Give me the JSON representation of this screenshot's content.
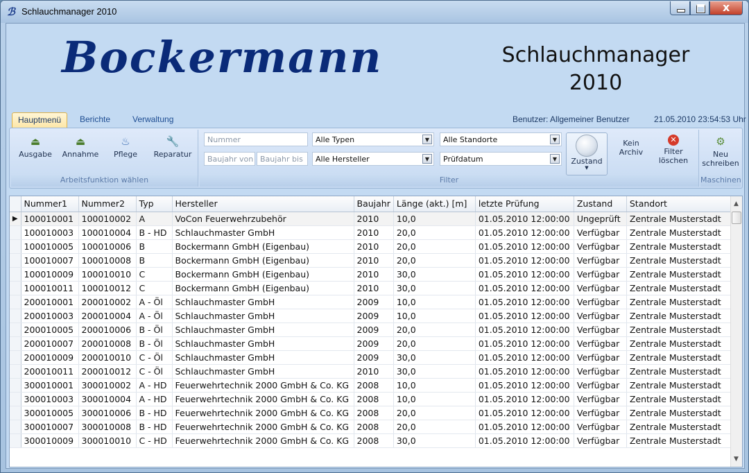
{
  "window": {
    "title": "Schlauchmanager 2010",
    "logo_glyph": "ℬ"
  },
  "header": {
    "brand": "Bockermann",
    "app_title_line1": "Schlauchmanager",
    "app_title_line2": "2010",
    "user": "Benutzer: Allgemeiner Benutzer",
    "datetime": "21.05.2010 23:54:53 Uhr"
  },
  "ribbon_tabs": [
    "Hauptmenü",
    "Berichte",
    "Verwaltung"
  ],
  "ribbon": {
    "arbeitsfunktion": {
      "label": "Arbeitsfunktion wählen",
      "buttons": [
        {
          "label": "Ausgabe",
          "icon": "hose-out-icon"
        },
        {
          "label": "Annahme",
          "icon": "hose-in-icon"
        },
        {
          "label": "Pflege",
          "icon": "care-icon"
        },
        {
          "label": "Reparatur",
          "icon": "wrench-icon"
        }
      ]
    },
    "filter": {
      "label": "Filter",
      "nummer_placeholder": "Nummer",
      "baujahr_von_placeholder": "Baujahr von",
      "baujahr_bis_placeholder": "Baujahr bis",
      "typ_value": "Alle Typen",
      "hersteller_value": "Alle Hersteller",
      "standort_value": "Alle Standorte",
      "pruefdatum_value": "Prüfdatum",
      "zustand_label": "Zustand",
      "kein_archiv_line1": "Kein",
      "kein_archiv_line2": "Archiv",
      "filter_loeschen_line1": "Filter",
      "filter_loeschen_line2": "löschen"
    },
    "maschinen": {
      "label": "Maschinen",
      "neu_line1": "Neu",
      "neu_line2": "schreiben"
    }
  },
  "table": {
    "columns": [
      "Nummer1",
      "Nummer2",
      "Typ",
      "Hersteller",
      "Baujahr",
      "Länge (akt.) [m]",
      "letzte Prüfung",
      "Zustand",
      "Standort"
    ],
    "rows": [
      [
        "100010001",
        "100010002",
        "A",
        "VoCon Feuerwehrzubehör",
        "2010",
        "10,0",
        "01.05.2010 12:00:00",
        "Ungeprüft",
        "Zentrale Musterstadt"
      ],
      [
        "100010003",
        "100010004",
        "B - HD",
        "Schlauchmaster GmbH",
        "2010",
        "20,0",
        "01.05.2010 12:00:00",
        "Verfügbar",
        "Zentrale Musterstadt"
      ],
      [
        "100010005",
        "100010006",
        "B",
        "Bockermann GmbH (Eigenbau)",
        "2010",
        "20,0",
        "01.05.2010 12:00:00",
        "Verfügbar",
        "Zentrale Musterstadt"
      ],
      [
        "100010007",
        "100010008",
        "B",
        "Bockermann GmbH (Eigenbau)",
        "2010",
        "20,0",
        "01.05.2010 12:00:00",
        "Verfügbar",
        "Zentrale Musterstadt"
      ],
      [
        "100010009",
        "100010010",
        "C",
        "Bockermann GmbH (Eigenbau)",
        "2010",
        "30,0",
        "01.05.2010 12:00:00",
        "Verfügbar",
        "Zentrale Musterstadt"
      ],
      [
        "100010011",
        "100010012",
        "C",
        "Bockermann GmbH (Eigenbau)",
        "2010",
        "30,0",
        "01.05.2010 12:00:00",
        "Verfügbar",
        "Zentrale Musterstadt"
      ],
      [
        "200010001",
        "200010002",
        "A - Öl",
        "Schlauchmaster GmbH",
        "2009",
        "10,0",
        "01.05.2010 12:00:00",
        "Verfügbar",
        "Zentrale Musterstadt"
      ],
      [
        "200010003",
        "200010004",
        "A - Öl",
        "Schlauchmaster GmbH",
        "2009",
        "10,0",
        "01.05.2010 12:00:00",
        "Verfügbar",
        "Zentrale Musterstadt"
      ],
      [
        "200010005",
        "200010006",
        "B - Öl",
        "Schlauchmaster GmbH",
        "2009",
        "20,0",
        "01.05.2010 12:00:00",
        "Verfügbar",
        "Zentrale Musterstadt"
      ],
      [
        "200010007",
        "200010008",
        "B - Öl",
        "Schlauchmaster GmbH",
        "2009",
        "20,0",
        "01.05.2010 12:00:00",
        "Verfügbar",
        "Zentrale Musterstadt"
      ],
      [
        "200010009",
        "200010010",
        "C - Öl",
        "Schlauchmaster GmbH",
        "2009",
        "30,0",
        "01.05.2010 12:00:00",
        "Verfügbar",
        "Zentrale Musterstadt"
      ],
      [
        "200010011",
        "200010012",
        "C - Öl",
        "Schlauchmaster GmbH",
        "2010",
        "30,0",
        "01.05.2010 12:00:00",
        "Verfügbar",
        "Zentrale Musterstadt"
      ],
      [
        "300010001",
        "300010002",
        "A - HD",
        "Feuerwehrtechnik 2000 GmbH & Co. KG",
        "2008",
        "10,0",
        "01.05.2010 12:00:00",
        "Verfügbar",
        "Zentrale Musterstadt"
      ],
      [
        "300010003",
        "300010004",
        "A - HD",
        "Feuerwehrtechnik 2000 GmbH & Co. KG",
        "2008",
        "10,0",
        "01.05.2010 12:00:00",
        "Verfügbar",
        "Zentrale Musterstadt"
      ],
      [
        "300010005",
        "300010006",
        "B - HD",
        "Feuerwehrtechnik 2000 GmbH & Co. KG",
        "2008",
        "20,0",
        "01.05.2010 12:00:00",
        "Verfügbar",
        "Zentrale Musterstadt"
      ],
      [
        "300010007",
        "300010008",
        "B - HD",
        "Feuerwehrtechnik 2000 GmbH & Co. KG",
        "2008",
        "20,0",
        "01.05.2010 12:00:00",
        "Verfügbar",
        "Zentrale Musterstadt"
      ],
      [
        "300010009",
        "300010010",
        "C - HD",
        "Feuerwehrtechnik 2000 GmbH & Co. KG",
        "2008",
        "30,0",
        "01.05.2010 12:00:00",
        "Verfügbar",
        "Zentrale Musterstadt"
      ]
    ]
  },
  "colors": {
    "brand": "#0a2a78",
    "accent": "#1d4c91",
    "close": "#c2402a"
  }
}
